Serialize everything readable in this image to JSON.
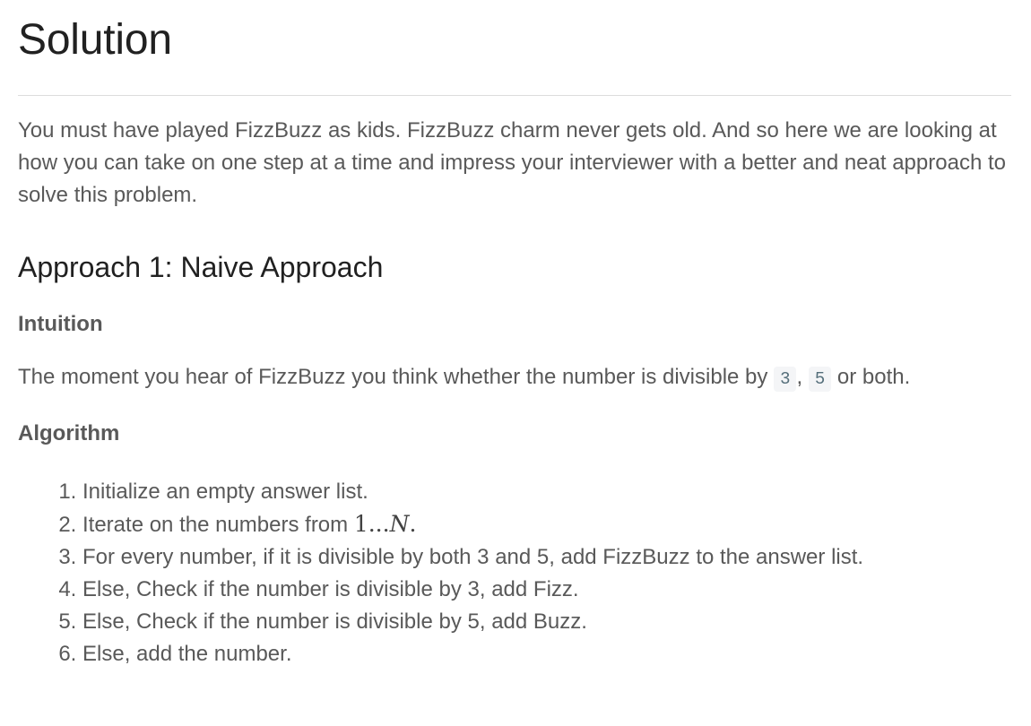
{
  "title": "Solution",
  "intro": "You must have played FizzBuzz as kids. FizzBuzz charm never gets old. And so here we are looking at how you can take on one step at a time and impress your interviewer with a better and neat approach to solve this problem.",
  "approach1": {
    "heading": "Approach 1: Naive Approach",
    "intuition_label": "Intuition",
    "intuition_text_before": "The moment you hear of FizzBuzz you think whether the number is divisible by ",
    "code_a": "3",
    "separator": ", ",
    "code_b": "5",
    "intuition_text_after": " or both.",
    "algorithm_label": "Algorithm",
    "steps": [
      "Initialize an empty answer list.",
      "Iterate on the numbers from ",
      "For every number, if it is divisible by both 3 and 5, add FizzBuzz to the answer list.",
      "Else, Check if the number is divisible by 3, add Fizz.",
      "Else, Check if the number is divisible by 5, add Buzz.",
      "Else, add the number."
    ],
    "step2_math_start": "1...",
    "step2_math_var": "N",
    "step2_math_end": "."
  }
}
